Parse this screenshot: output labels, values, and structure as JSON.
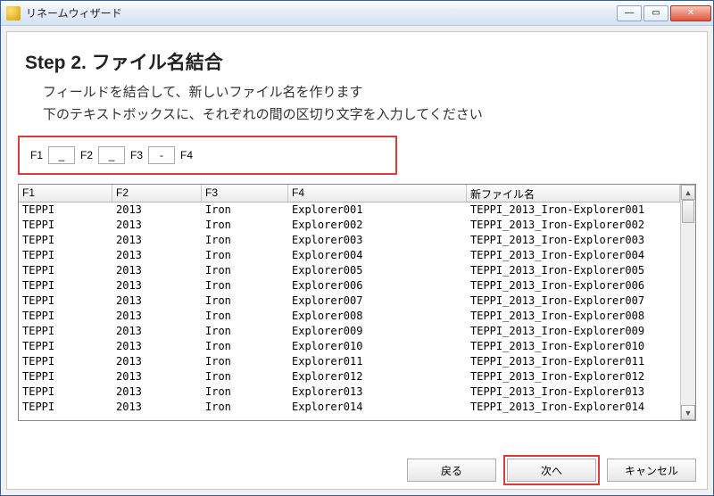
{
  "window": {
    "title": "リネームウィザード"
  },
  "step": {
    "heading": "Step 2. ファイル名結合",
    "line1": "フィールドを結合して、新しいファイル名を作ります",
    "line2": "下のテキストボックスに、それぞれの間の区切り文字を入力してください"
  },
  "separators": {
    "labels": [
      "F1",
      "F2",
      "F3",
      "F4"
    ],
    "values": [
      "_",
      "_",
      "-"
    ]
  },
  "table": {
    "headers": {
      "f1": "F1",
      "f2": "F2",
      "f3": "F3",
      "f4": "F4",
      "filename": "新ファイル名"
    },
    "rows": [
      {
        "f1": "TEPPI",
        "f2": "2013",
        "f3": "Iron",
        "f4": "Explorer001",
        "filename": "TEPPI_2013_Iron-Explorer001"
      },
      {
        "f1": "TEPPI",
        "f2": "2013",
        "f3": "Iron",
        "f4": "Explorer002",
        "filename": "TEPPI_2013_Iron-Explorer002"
      },
      {
        "f1": "TEPPI",
        "f2": "2013",
        "f3": "Iron",
        "f4": "Explorer003",
        "filename": "TEPPI_2013_Iron-Explorer003"
      },
      {
        "f1": "TEPPI",
        "f2": "2013",
        "f3": "Iron",
        "f4": "Explorer004",
        "filename": "TEPPI_2013_Iron-Explorer004"
      },
      {
        "f1": "TEPPI",
        "f2": "2013",
        "f3": "Iron",
        "f4": "Explorer005",
        "filename": "TEPPI_2013_Iron-Explorer005"
      },
      {
        "f1": "TEPPI",
        "f2": "2013",
        "f3": "Iron",
        "f4": "Explorer006",
        "filename": "TEPPI_2013_Iron-Explorer006"
      },
      {
        "f1": "TEPPI",
        "f2": "2013",
        "f3": "Iron",
        "f4": "Explorer007",
        "filename": "TEPPI_2013_Iron-Explorer007"
      },
      {
        "f1": "TEPPI",
        "f2": "2013",
        "f3": "Iron",
        "f4": "Explorer008",
        "filename": "TEPPI_2013_Iron-Explorer008"
      },
      {
        "f1": "TEPPI",
        "f2": "2013",
        "f3": "Iron",
        "f4": "Explorer009",
        "filename": "TEPPI_2013_Iron-Explorer009"
      },
      {
        "f1": "TEPPI",
        "f2": "2013",
        "f3": "Iron",
        "f4": "Explorer010",
        "filename": "TEPPI_2013_Iron-Explorer010"
      },
      {
        "f1": "TEPPI",
        "f2": "2013",
        "f3": "Iron",
        "f4": "Explorer011",
        "filename": "TEPPI_2013_Iron-Explorer011"
      },
      {
        "f1": "TEPPI",
        "f2": "2013",
        "f3": "Iron",
        "f4": "Explorer012",
        "filename": "TEPPI_2013_Iron-Explorer012"
      },
      {
        "f1": "TEPPI",
        "f2": "2013",
        "f3": "Iron",
        "f4": "Explorer013",
        "filename": "TEPPI_2013_Iron-Explorer013"
      },
      {
        "f1": "TEPPI",
        "f2": "2013",
        "f3": "Iron",
        "f4": "Explorer014",
        "filename": "TEPPI_2013_Iron-Explorer014"
      }
    ]
  },
  "buttons": {
    "back": "戻る",
    "next": "次へ",
    "cancel": "キャンセル"
  }
}
